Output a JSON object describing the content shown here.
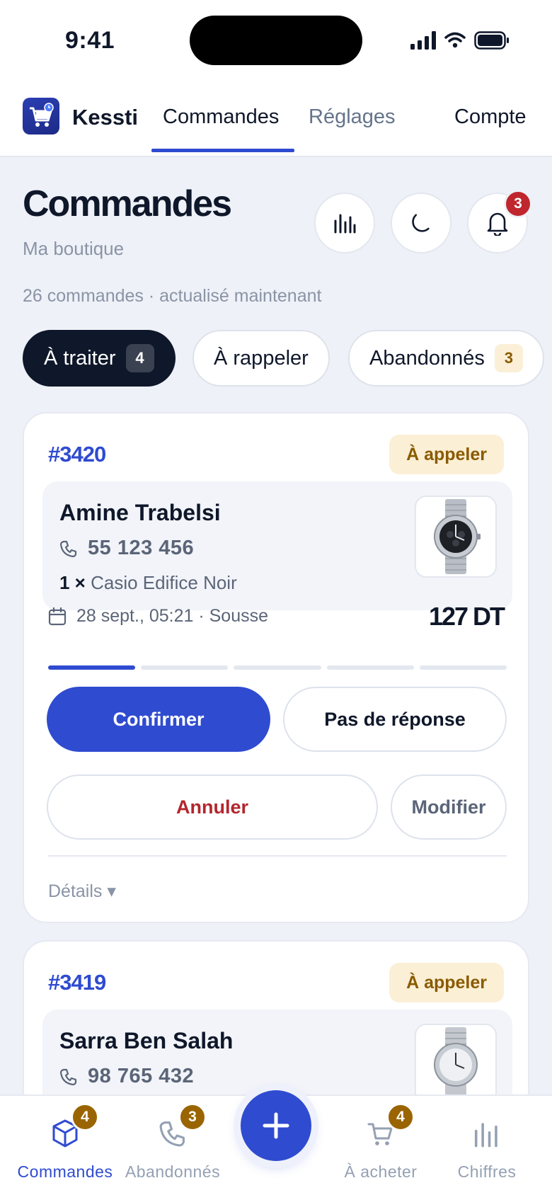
{
  "status_bar": {
    "time": "9:41"
  },
  "topnav": {
    "brand": "Kessti",
    "tabs": [
      {
        "label": "Commandes",
        "active": true
      },
      {
        "label": "Réglages",
        "active": false
      }
    ],
    "account": "Compte"
  },
  "header": {
    "title": "Commandes",
    "subtitle": "Ma boutique",
    "notifications_count": "3",
    "meta": "26 commandes · actualisé maintenant"
  },
  "filters": [
    {
      "label": "À traiter",
      "count": "4",
      "active": true
    },
    {
      "label": "À rappeler",
      "count": "",
      "active": false
    },
    {
      "label": "Abandonnés",
      "count": "3",
      "active": false
    }
  ],
  "orders": [
    {
      "id": "#3420",
      "status": "À appeler",
      "customer": "Amine Trabelsi",
      "phone": "55 123 456",
      "qty": "1 ×",
      "product": "Casio Edifice Noir",
      "date": "28 sept., 05:21 · Sousse",
      "amount": "127 DT",
      "progress_step": 1,
      "progress_total": 5,
      "actions": {
        "confirm": "Confirmer",
        "no_answer": "Pas de réponse",
        "cancel": "Annuler",
        "edit": "Modifier"
      },
      "details": "Détails ▾"
    },
    {
      "id": "#3419",
      "status": "À appeler",
      "customer": "Sarra Ben Salah",
      "phone": "98 765 432"
    }
  ],
  "bottom_nav": [
    {
      "label": "Commandes",
      "badge": "4",
      "icon": "box-icon",
      "active": true
    },
    {
      "label": "Abandonnés",
      "badge": "3",
      "icon": "phone-icon",
      "active": false
    },
    {
      "label": "À acheter",
      "badge": "4",
      "icon": "cart-icon",
      "active": false
    },
    {
      "label": "Chiffres",
      "badge": "",
      "icon": "bar-chart-icon",
      "active": false
    }
  ],
  "colors": {
    "accent": "#2f4bd0",
    "dark": "#0f172a",
    "warning_bg": "#fbefd5",
    "warning_text": "#8a5a00",
    "danger": "#b3262d",
    "badge_red": "#c0262d",
    "badge_amber": "#9a6500"
  }
}
